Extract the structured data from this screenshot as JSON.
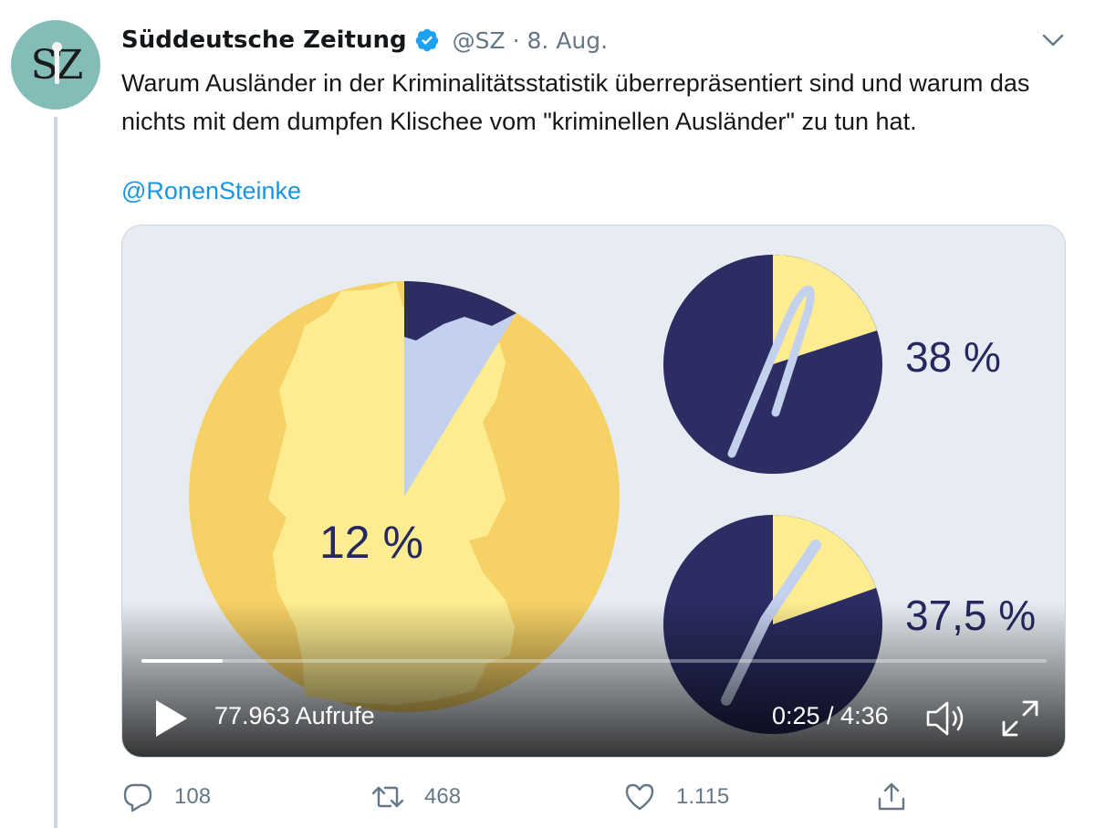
{
  "tweet": {
    "author": {
      "display_name": "Süddeutsche Zeitung",
      "handle": "@SZ",
      "verified": true,
      "avatar_text": "SZ",
      "avatar_color": "#84bdb7"
    },
    "separator": "·",
    "date": "8. Aug.",
    "text": "Warum Ausländer in der Kriminalitätsstatistik überrepräsentiert sind und warum das nichts mit dem dumpfen Klischee vom \"kriminellen Ausländer\" zu tun hat.",
    "mention": "@RonenSteinke",
    "media": {
      "type": "video",
      "views_label": "77.963 Aufrufe",
      "time_label": "0:25 / 4:36",
      "progress_fraction": 0.09,
      "frame_labels": {
        "main": "12 %",
        "top": "38 %",
        "bottom": "37,5 %"
      },
      "colors": {
        "background": "#e6ecf2",
        "yellow": "#f6d166",
        "light_yellow": "#fdec90",
        "navy": "#2b2d63",
        "light_blue": "#c4d1ee"
      }
    },
    "actions": {
      "replies": "108",
      "retweets": "468",
      "likes": "1.115"
    },
    "icons": [
      "verified-badge-icon",
      "chevron-down-icon",
      "play-icon",
      "volume-icon",
      "fullscreen-icon",
      "reply-icon",
      "retweet-icon",
      "like-icon",
      "share-icon"
    ],
    "accent_color": "#1b95e0"
  }
}
